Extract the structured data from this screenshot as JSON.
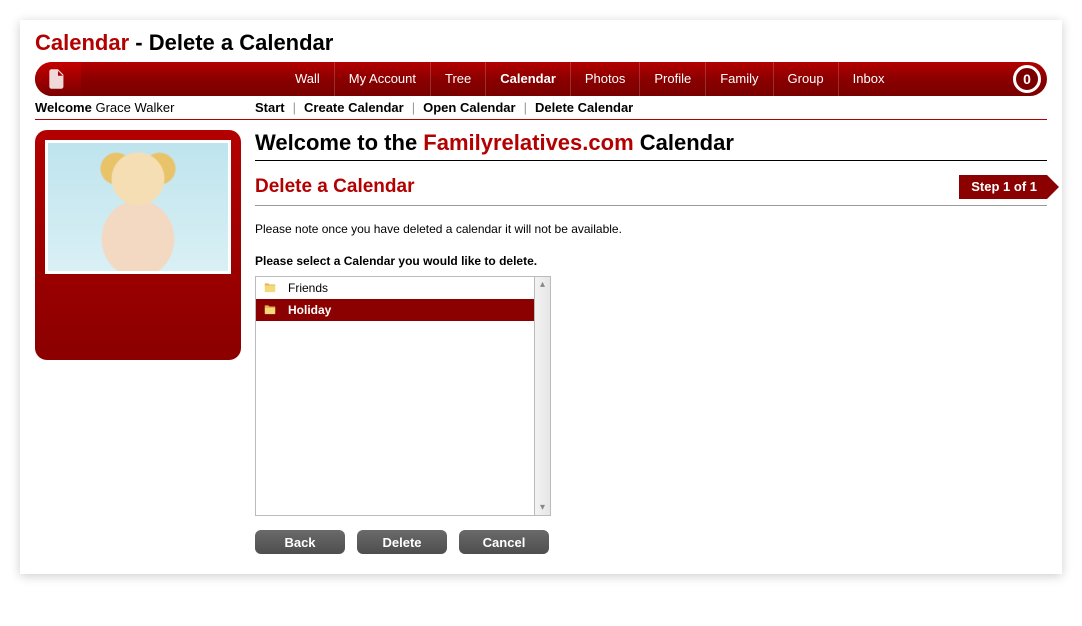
{
  "pageTitle": {
    "prefix": "Calendar",
    "separator": " - ",
    "suffix": "Delete a Calendar"
  },
  "nav": {
    "items": [
      {
        "label": "Wall",
        "active": false
      },
      {
        "label": "My Account",
        "active": false
      },
      {
        "label": "Tree",
        "active": false
      },
      {
        "label": "Calendar",
        "active": true
      },
      {
        "label": "Photos",
        "active": false
      },
      {
        "label": "Profile",
        "active": false
      },
      {
        "label": "Family",
        "active": false
      },
      {
        "label": "Group",
        "active": false
      },
      {
        "label": "Inbox",
        "active": false
      }
    ],
    "inboxCount": "0"
  },
  "welcome": {
    "label": "Welcome",
    "user": "Grace Walker"
  },
  "subnav": [
    "Start",
    "Create Calendar",
    "Open Calendar",
    "Delete Calendar"
  ],
  "mainTitle": {
    "pre": "Welcome to the ",
    "brand": "Familyrelatives.com",
    "post": " Calendar"
  },
  "sectionHeading": "Delete a Calendar",
  "stepLabel": "Step 1 of 1",
  "note": "Please note once you have deleted a calendar it will not be available.",
  "prompt": "Please select a Calendar you would like to delete.",
  "calendars": [
    {
      "name": "Friends",
      "selected": false
    },
    {
      "name": "Holiday",
      "selected": true
    }
  ],
  "buttons": {
    "back": "Back",
    "delete": "Delete",
    "cancel": "Cancel"
  }
}
